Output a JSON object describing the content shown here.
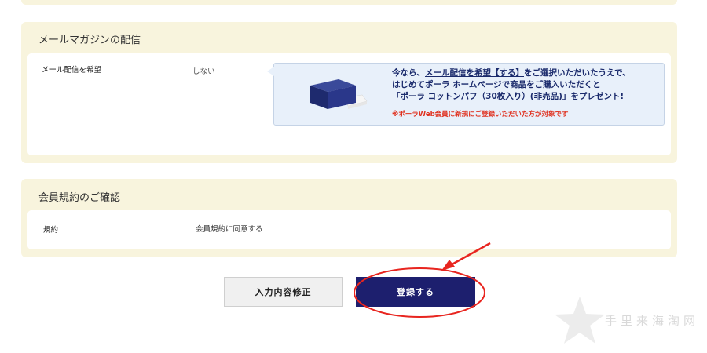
{
  "mail_section": {
    "title": "メールマガジンの配信",
    "row_label": "メール配信を希望",
    "row_value": "しない",
    "promo": {
      "line1_prefix": "今なら、",
      "line1_link": "メール配信を希望【する】",
      "line1_suffix": "をご選択いただいたうえで、",
      "line2": "はじめてポーラ ホームページで商品をご購入いただくと",
      "line3_link": "「ポーラ コットンパフ（30枚入り）(非売品)」",
      "line3_suffix": "をプレゼント!",
      "note": "※ポーラWeb会員に新規にご登録いただいた方が対象です"
    }
  },
  "terms_section": {
    "title": "会員規約のご確認",
    "row_label": "規約",
    "row_value": "会員規約に同意する"
  },
  "buttons": {
    "edit_label": "入力内容修正",
    "register_label": "登録する"
  },
  "watermark": {
    "text": "手里来海淘网"
  },
  "colors": {
    "panel_bg": "#f8f4dd",
    "register_button": "#1d1f6e",
    "promo_text": "#1a2a6c",
    "promo_note": "#e0301e",
    "annotation_red": "#e8251f"
  }
}
